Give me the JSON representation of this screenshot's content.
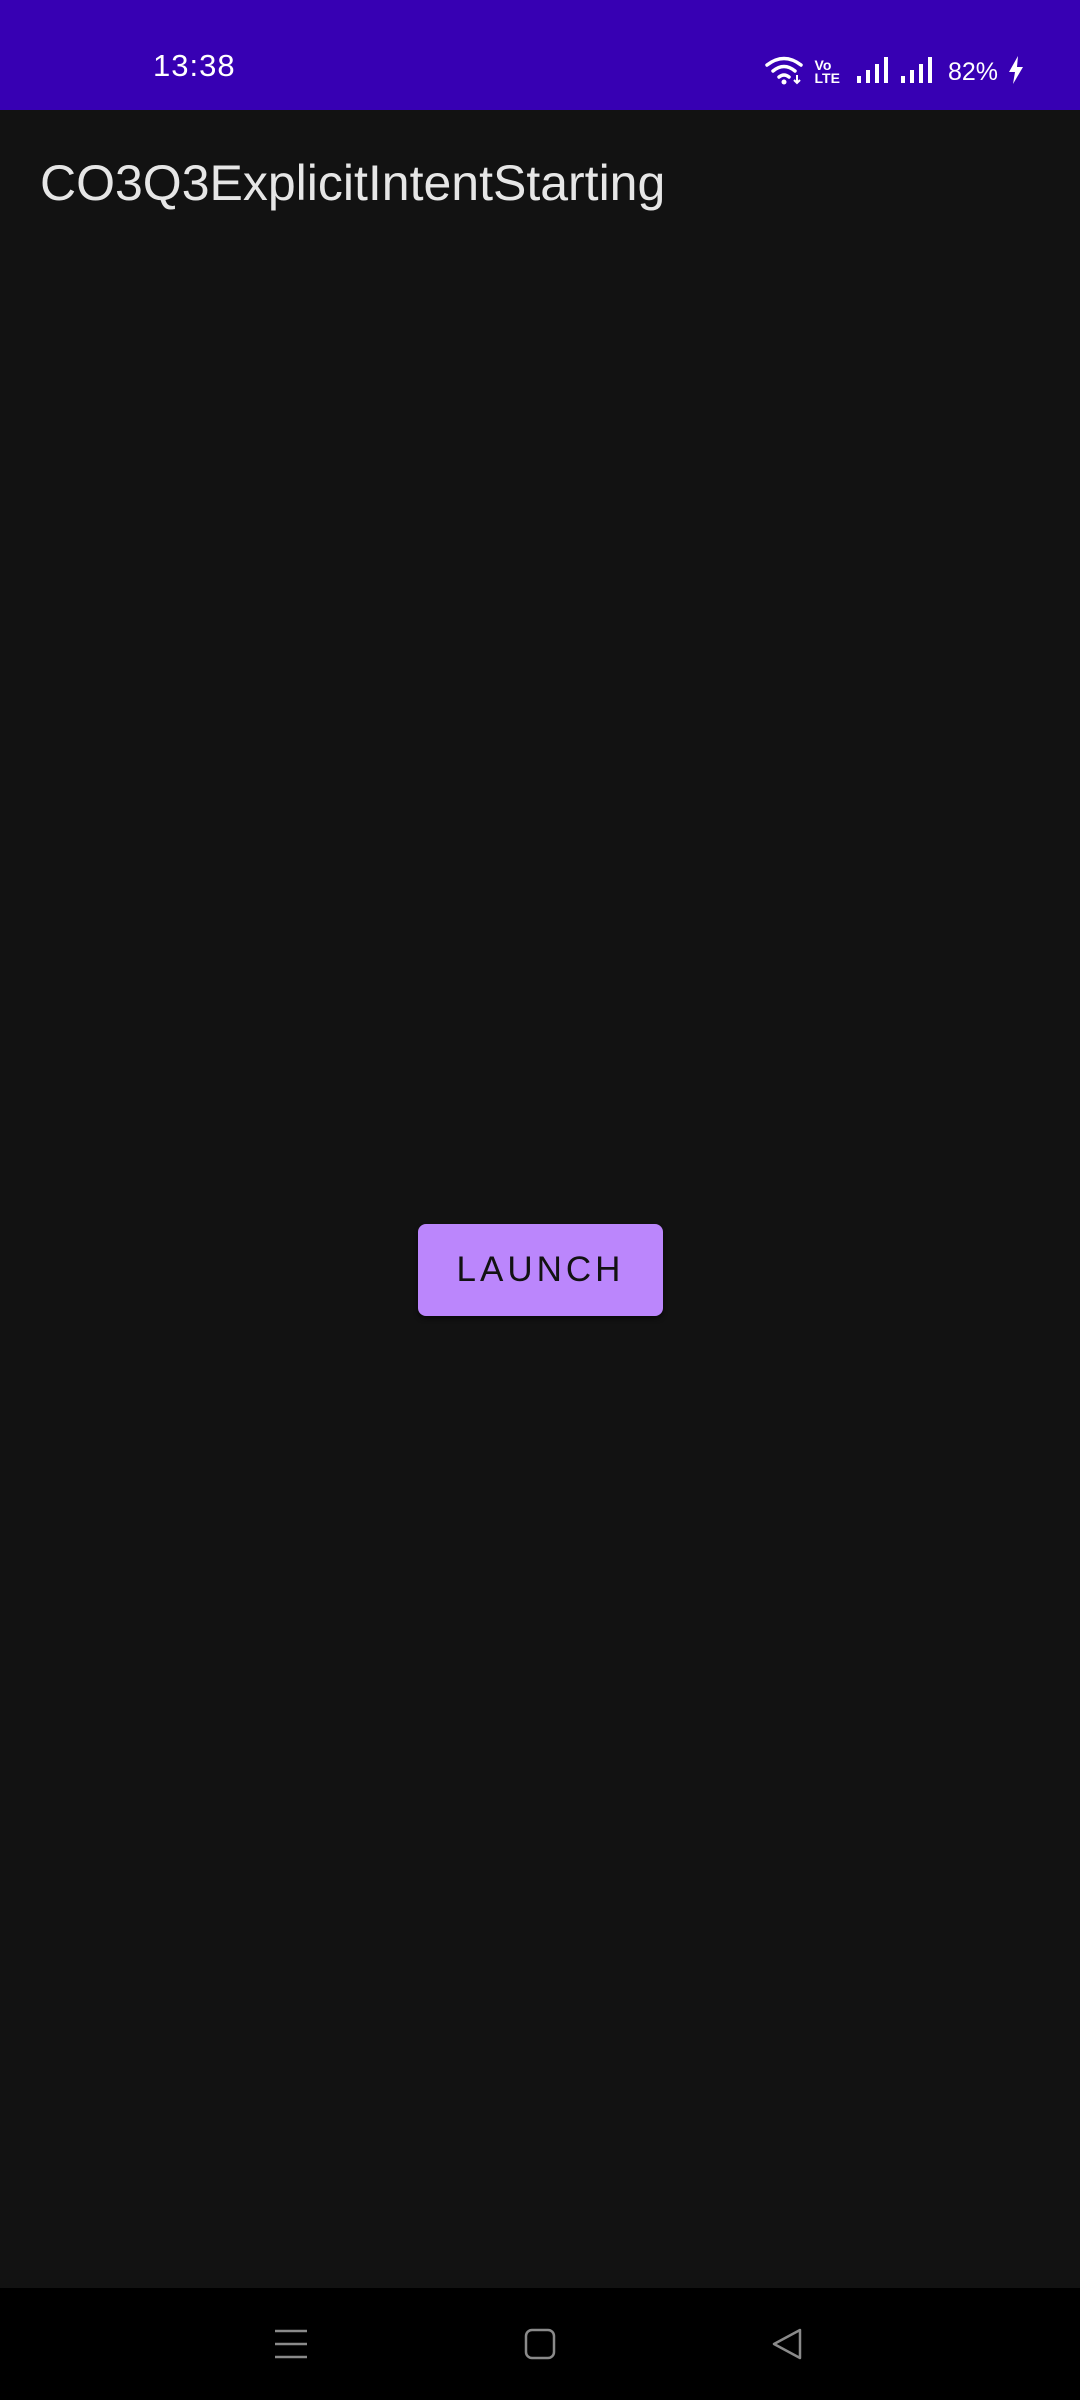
{
  "status_bar": {
    "time": "13:38",
    "volte_top": "Vo",
    "volte_bottom": "LTE",
    "battery_percent": "82%",
    "icons": [
      "wifi-icon",
      "volte-icon",
      "signal-sim1-icon",
      "signal-sim2-icon",
      "charging-bolt-icon"
    ],
    "background_color": "#3700b3"
  },
  "app_bar": {
    "title": "CO3Q3ExplicitIntentStarting"
  },
  "main": {
    "launch_button_label": "LAUNCH",
    "accent_color": "#bb86fc"
  },
  "nav_bar": {
    "icons": [
      "menu-icon",
      "home-icon",
      "back-icon"
    ]
  }
}
